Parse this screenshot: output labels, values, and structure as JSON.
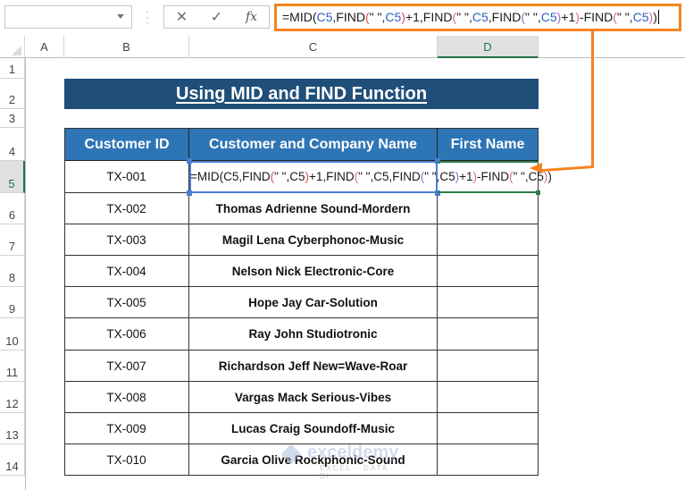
{
  "formula_bar": {
    "name_box_value": "",
    "cancel_icon": "✕",
    "enter_icon": "✓",
    "fx_label": "fx",
    "formula_parts": [
      {
        "t": "=MID(",
        "c": ""
      },
      {
        "t": "C5",
        "c": "ref-blue"
      },
      {
        "t": ",FIND",
        "c": ""
      },
      {
        "t": "(",
        "c": "par-red"
      },
      {
        "t": "\" \",",
        "c": ""
      },
      {
        "t": "C5",
        "c": "ref-blue"
      },
      {
        "t": ")",
        "c": "par-red"
      },
      {
        "t": "+1,FIND",
        "c": ""
      },
      {
        "t": "(",
        "c": "par-pink"
      },
      {
        "t": "\" \",",
        "c": ""
      },
      {
        "t": "C5",
        "c": "ref-blue"
      },
      {
        "t": ",FIND",
        "c": ""
      },
      {
        "t": "(",
        "c": "par-purple"
      },
      {
        "t": "\" \",",
        "c": ""
      },
      {
        "t": "C5",
        "c": "ref-blue"
      },
      {
        "t": ")",
        "c": "par-purple"
      },
      {
        "t": "+1",
        "c": ""
      },
      {
        "t": ")",
        "c": "par-pink"
      },
      {
        "t": "-FIND",
        "c": ""
      },
      {
        "t": "(",
        "c": "par-pink"
      },
      {
        "t": "\" \",",
        "c": ""
      },
      {
        "t": "C5",
        "c": "ref-blue"
      },
      {
        "t": ")",
        "c": "par-pink"
      },
      {
        "t": ")",
        "c": ""
      }
    ]
  },
  "columns": [
    "A",
    "B",
    "C",
    "D"
  ],
  "active_column": "D",
  "rows": [
    "1",
    "2",
    "3",
    "4",
    "5",
    "6",
    "7",
    "8",
    "9",
    "10",
    "11",
    "12",
    "13",
    "14"
  ],
  "active_row": "5",
  "title": "Using MID and FIND Function",
  "table": {
    "headers": [
      "Customer ID",
      "Customer and Company Name",
      "First Name"
    ],
    "rows": [
      {
        "id": "TX-001",
        "name": "",
        "first": ""
      },
      {
        "id": "TX-002",
        "name": "Thomas Adrienne Sound-Mordern",
        "first": ""
      },
      {
        "id": "TX-003",
        "name": "Magil Lena Cyberphonoc-Music",
        "first": ""
      },
      {
        "id": "TX-004",
        "name": "Nelson Nick Electronic-Core",
        "first": ""
      },
      {
        "id": "TX-005",
        "name": "Hope Jay Car-Solution",
        "first": ""
      },
      {
        "id": "TX-006",
        "name": "Ray John Studiotronic",
        "first": ""
      },
      {
        "id": "TX-007",
        "name": "Richardson Jeff New=Wave-Roar",
        "first": ""
      },
      {
        "id": "TX-008",
        "name": "Vargas Mack Serious-Vibes",
        "first": ""
      },
      {
        "id": "TX-009",
        "name": "Lucas Craig Soundoff-Music",
        "first": ""
      },
      {
        "id": "TX-010",
        "name": "Garcia Olive Rockphonic-Sound",
        "first": ""
      }
    ]
  },
  "editing_cell": "C5",
  "colors": {
    "title_bg": "#1f4e79",
    "header_bg": "#2e75b6",
    "callout": "#f5841f",
    "selection_green": "#217346"
  },
  "watermark": {
    "brand": "exceldemy",
    "tagline": "EXCEL · DATA · BI"
  }
}
